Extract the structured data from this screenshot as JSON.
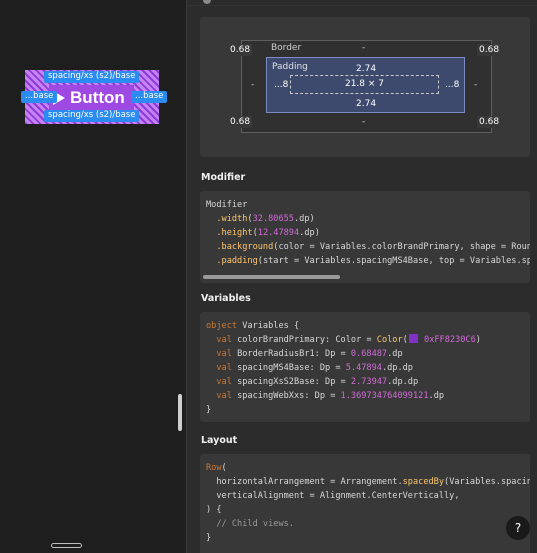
{
  "canvas": {
    "spacing_top": "spacing/xs (s2)/base",
    "spacing_bottom": "spacing/xs (s2)/base",
    "spacing_left": "...base",
    "spacing_right": "...base",
    "button_text": "Button",
    "colors": {
      "frame": "#8f3ad9",
      "tag": "#2a8cf0"
    }
  },
  "box_model": {
    "border_label": "Border",
    "padding_label": "Padding",
    "corner_tl": "0.68",
    "corner_tr": "0.68",
    "corner_bl": "0.68",
    "corner_br": "0.68",
    "border_top": "-",
    "border_bottom": "-",
    "border_left": "-",
    "border_right": "-",
    "padding_top": "2.74",
    "padding_bottom": "2.74",
    "padding_left": "...8",
    "padding_right": "...8",
    "content_size": "21.8 × 7"
  },
  "sections": {
    "modifier_title": "Modifier",
    "variables_title": "Variables",
    "layout_title": "Layout"
  },
  "modifier_code": {
    "l1": "Modifier",
    "l2_fn": ".width",
    "l2_num": "32.80655",
    "l2_rest": ".dp)",
    "l3_fn": ".height",
    "l3_num": "12.47894",
    "l3_rest": ".dp)",
    "l4_fn": ".background",
    "l4_rest": "(color = Variables.colorBrandPrimary, shape = Roun",
    "l5_fn": ".padding",
    "l5_rest": "(start = Variables.spacingMS4Base, top = Variables.sp"
  },
  "variables_code": {
    "l1_kw": "object",
    "l1_rest": " Variables {",
    "l2_kw": "val",
    "l2_rest": " colorBrandPrimary: Color = ",
    "l2_fn": "Color",
    "l2_str": "0xFF8230C6",
    "l3_kw": "val",
    "l3_rest": " BorderRadiusBr1: Dp = ",
    "l3_num": "0.68487",
    "l3_end": ".dp",
    "l4_kw": "val",
    "l4_rest": " spacingMS4Base: Dp = ",
    "l4_num": "5.47894",
    "l4_end": ".dp.dp",
    "l5_kw": "val",
    "l5_rest": " spacingXsS2Base: Dp = ",
    "l5_num": "2.73947",
    "l5_end": ".dp.dp",
    "l6_kw": "val",
    "l6_rest": " spacingWebXxs: Dp = ",
    "l6_num": "1.369734764099121",
    "l6_end": ".dp",
    "l7": "}"
  },
  "layout_code": {
    "l1_fn": "Row",
    "l1_rest": "(",
    "l2_a": "horizontalArrangement = Arrangement.",
    "l2_fn": "spacedBy",
    "l2_b": "(Variables.spacin",
    "l3": "verticalAlignment = Alignment.CenterVertically,",
    "l4": ") {",
    "l5": "// Child views.",
    "l6": "}"
  },
  "help_label": "?"
}
